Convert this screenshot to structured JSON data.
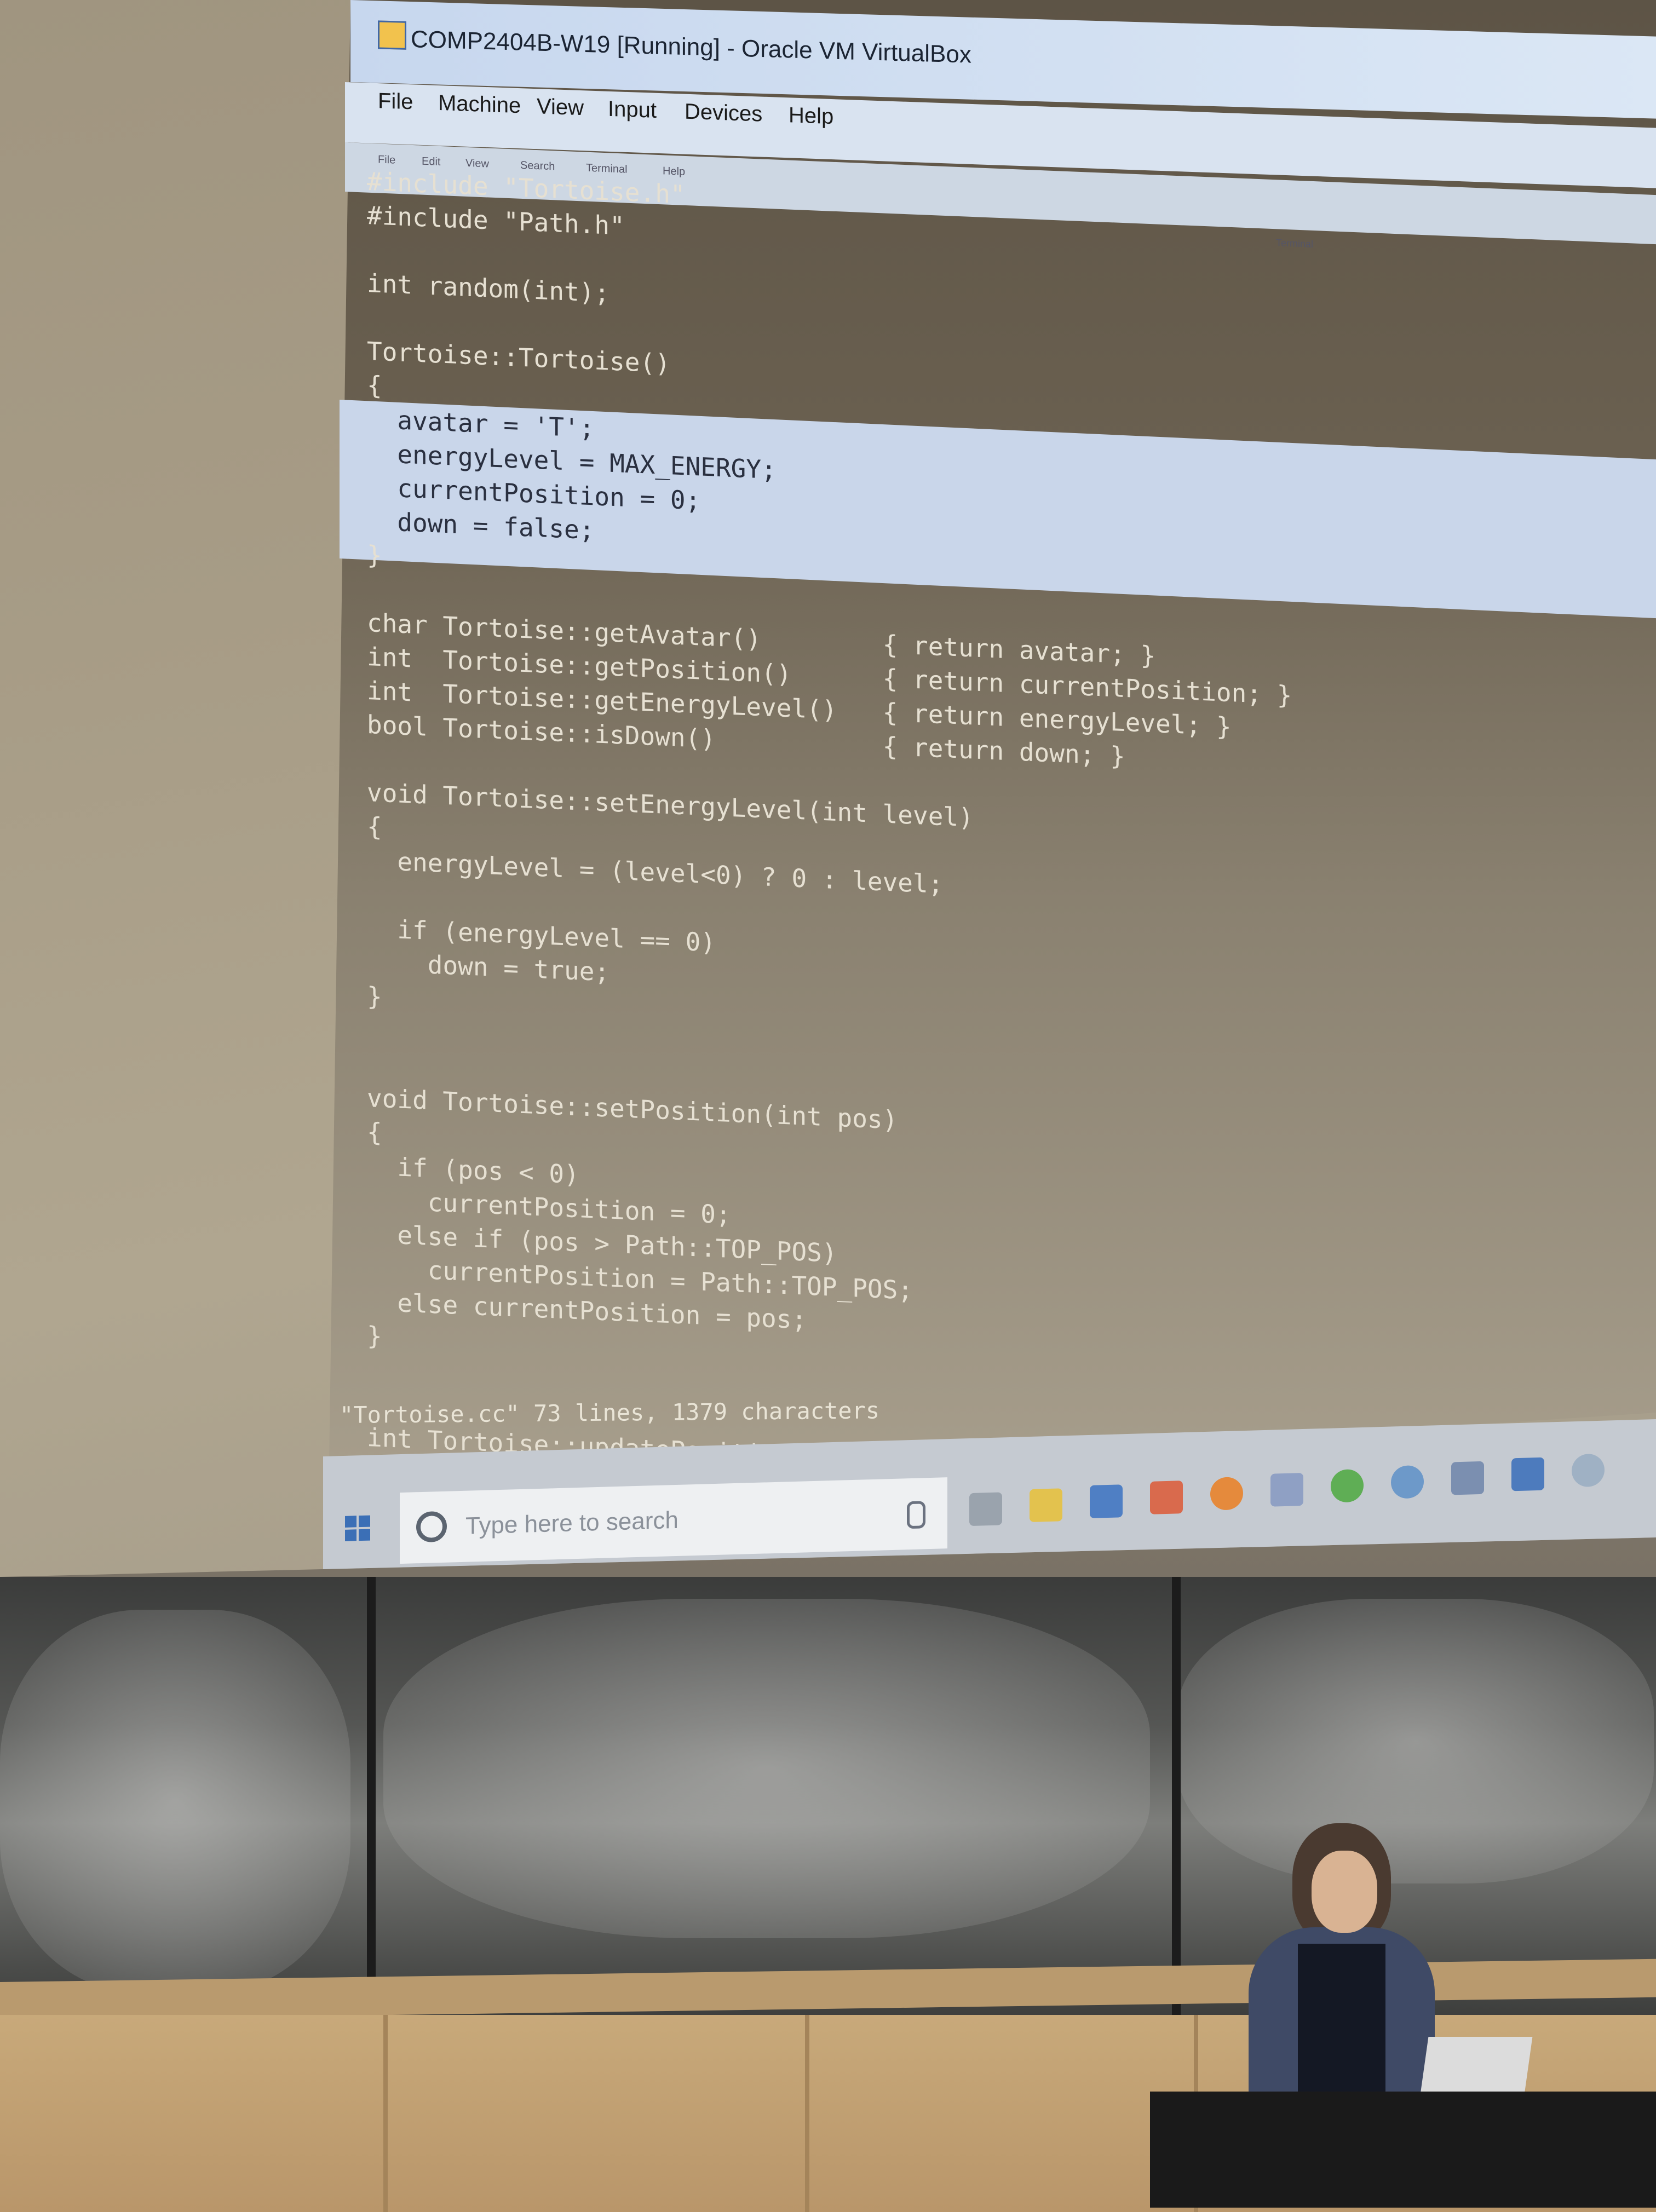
{
  "window": {
    "title": "COMP2404B-W19 [Running] - Oracle VM VirtualBox"
  },
  "menubar": {
    "items": [
      "File",
      "Machine",
      "View",
      "Input",
      "Devices",
      "Help"
    ]
  },
  "terminal_menu": {
    "items": [
      "File",
      "Edit",
      "View",
      "Search",
      "Terminal",
      "Help"
    ],
    "title": "Terminal"
  },
  "code": {
    "lines": [
      "#include \"Tortoise.h\"",
      "#include \"Path.h\"",
      "",
      "int random(int);",
      "",
      "Tortoise::Tortoise()",
      "{",
      "  avatar = 'T';",
      "  energyLevel = MAX_ENERGY;",
      "  currentPosition = 0;",
      "  down = false;",
      "}",
      "",
      "char Tortoise::getAvatar()        { return avatar; }",
      "int  Tortoise::getPosition()      { return currentPosition; }",
      "int  Tortoise::getEnergyLevel()   { return energyLevel; }",
      "bool Tortoise::isDown()           { return down; }",
      "",
      "void Tortoise::setEnergyLevel(int level)",
      "{",
      "  energyLevel = (level<0) ? 0 : level;",
      "",
      "  if (energyLevel == 0)",
      "    down = true;",
      "}",
      "",
      "",
      "void Tortoise::setPosition(int pos)",
      "{",
      "  if (pos < 0)",
      "    currentPosition = 0;",
      "  else if (pos > Path::TOP_POS)",
      "    currentPosition = Path::TOP_POS;",
      "  else currentPosition = pos;",
      "}",
      "",
      "",
      "int Tortoise::updatePosition()"
    ],
    "status": "\"Tortoise.cc\" 73 lines, 1379 characters"
  },
  "taskbar": {
    "search_placeholder": "Type here to search",
    "icons": [
      "task-view-icon",
      "file-explorer-icon",
      "edge-icon",
      "app-icon",
      "firefox-icon",
      "virtualbox-icon",
      "sync-icon",
      "chrome-icon",
      "store-icon",
      "mail-icon",
      "notification-icon"
    ]
  },
  "colors": {
    "titlebar": "#c7d7ee",
    "highlight": "#c9d6ea",
    "taskbar": "#c5cad1"
  }
}
